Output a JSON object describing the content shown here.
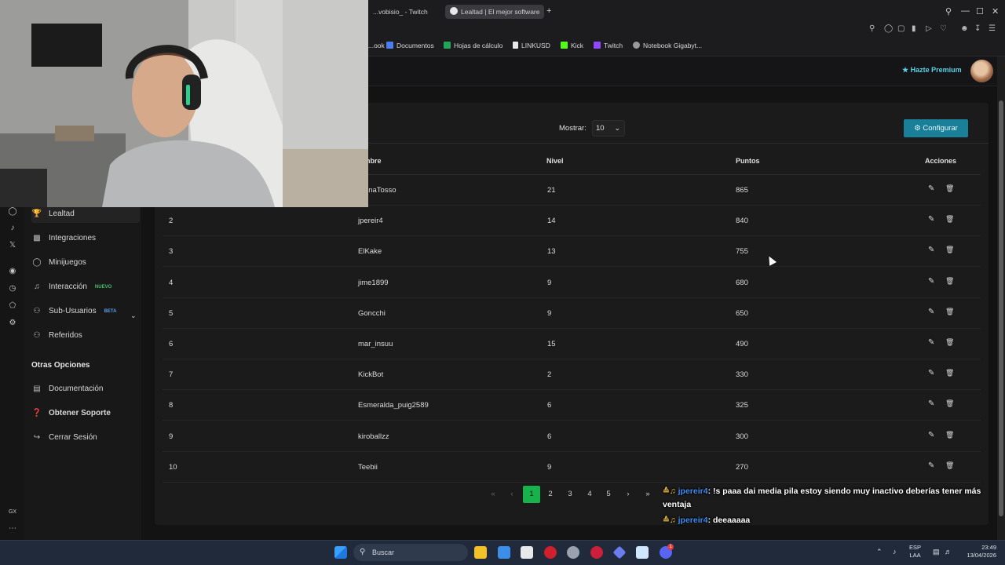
{
  "browser": {
    "tabs": [
      {
        "label": "...vobisio_ - Twitch",
        "active": false
      },
      {
        "label": "Lealtad | El mejor software",
        "active": true
      }
    ],
    "new_tab": "+",
    "bookmarks": [
      {
        "label": "...ook",
        "icon": "bookmark-icon",
        "color": "#888888"
      },
      {
        "label": "Documentos",
        "icon": "docs-icon",
        "color": "#4a7ef0"
      },
      {
        "label": "Hojas de cálculo",
        "icon": "sheets-icon",
        "color": "#22a559"
      },
      {
        "label": "LINKUSD",
        "icon": "linkusd-icon",
        "color": "#e8e8e8"
      },
      {
        "label": "Kick",
        "icon": "kick-icon",
        "color": "#53fc18"
      },
      {
        "label": "Twitch",
        "icon": "twitch-icon",
        "color": "#9146ff"
      },
      {
        "label": "Notebook Gigabyt...",
        "icon": "gigabyte-icon",
        "color": "#9a9a9a"
      }
    ]
  },
  "header": {
    "premium_label": "Hazte Premium",
    "premium_icon": "star-icon",
    "accent_color": "#5bd0e6"
  },
  "sidebar": {
    "items": [
      {
        "label": "Lealtad",
        "icon": "trophy-icon",
        "active": true
      },
      {
        "label": "Integraciones",
        "icon": "integrations-icon"
      },
      {
        "label": "Minijuegos",
        "icon": "gamepad-icon"
      },
      {
        "label": "Interacción",
        "icon": "music-icon",
        "badge": "NUEVO"
      },
      {
        "label": "Sub-Usuarios",
        "icon": "users-icon",
        "badge": "BETA"
      },
      {
        "label": "Referidos",
        "icon": "referral-icon"
      }
    ],
    "section_title": "Otras Opciones",
    "other_items": [
      {
        "label": "Documentación",
        "icon": "document-icon"
      },
      {
        "label": "Obtener Soporte",
        "icon": "help-icon"
      },
      {
        "label": "Cerrar Sesión",
        "icon": "logout-icon"
      }
    ],
    "rail_footer": "GX"
  },
  "controls": {
    "show_label": "Mostrar:",
    "show_value": "10",
    "config_label": "Configurar",
    "config_color": "#1a7f98"
  },
  "table": {
    "headers": [
      "...mbre",
      "Nivel",
      "Puntos",
      "Acciones"
    ],
    "rows": [
      {
        "rank": "",
        "name": "...anaTosso",
        "level": "21",
        "points": "865"
      },
      {
        "rank": "2",
        "name": "jpereir4",
        "level": "14",
        "points": "840"
      },
      {
        "rank": "3",
        "name": "ElKake",
        "level": "13",
        "points": "755"
      },
      {
        "rank": "4",
        "name": "jime1899",
        "level": "9",
        "points": "680"
      },
      {
        "rank": "5",
        "name": "Goncchi",
        "level": "9",
        "points": "650"
      },
      {
        "rank": "6",
        "name": "mar_insuu",
        "level": "15",
        "points": "490"
      },
      {
        "rank": "7",
        "name": "KickBot",
        "level": "2",
        "points": "330"
      },
      {
        "rank": "8",
        "name": "Esmeralda_puig2589",
        "level": "6",
        "points": "325"
      },
      {
        "rank": "9",
        "name": "kiroballzz",
        "level": "6",
        "points": "300"
      },
      {
        "rank": "10",
        "name": "Teebii",
        "level": "9",
        "points": "270"
      }
    ]
  },
  "pagination": {
    "first": "«",
    "prev": "‹",
    "pages": [
      "1",
      "2",
      "3",
      "4",
      "5"
    ],
    "current": "1",
    "next": "›",
    "last": "»",
    "active_color": "#17b24c"
  },
  "chat": [
    {
      "user": "jpereir4",
      "message": ": !s paaa dai media pila estoy siendo muy inactivo deberías tener más ventaja"
    },
    {
      "user": "jpereir4",
      "message": ": deeaaaaa"
    }
  ],
  "taskbar": {
    "search_placeholder": "Buscar",
    "lang": "ESP",
    "lang_sub": "LAA",
    "time": "23:49",
    "date": "13/04/2026",
    "notification_count": "1"
  }
}
